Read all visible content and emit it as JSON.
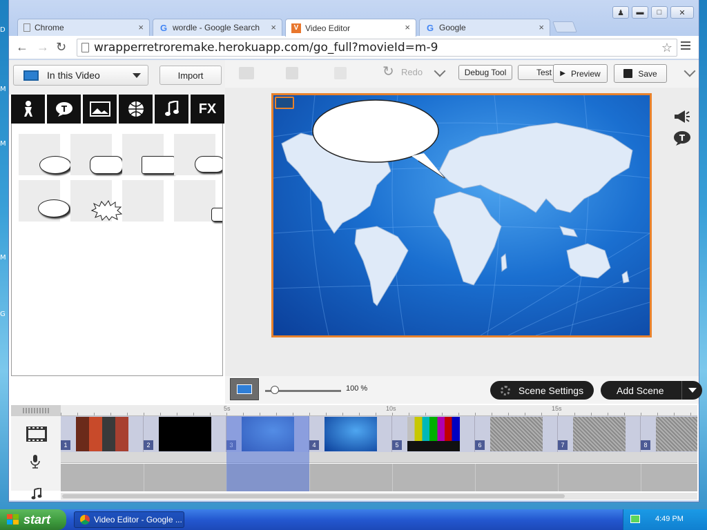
{
  "desktop": {
    "edge_letters": [
      "D",
      "M",
      "M",
      "G"
    ]
  },
  "browser": {
    "tabs": [
      {
        "label": "Chrome",
        "icon": "page-icon"
      },
      {
        "label": "wordle - Google Search",
        "icon": "google-icon"
      },
      {
        "label": "Video Editor",
        "icon": "v-logo-icon",
        "active": true
      },
      {
        "label": "Google",
        "icon": "google-icon"
      }
    ],
    "window_controls": [
      "user-icon",
      "minimize-icon",
      "maximize-icon",
      "close-icon"
    ],
    "url": "wrapperretroremake.herokuapp.com/go_full?movieId=m-9"
  },
  "library": {
    "dropdown_label": "In this Video",
    "import_label": "Import",
    "categories": [
      {
        "icon": "character-icon"
      },
      {
        "icon": "text-bubble-icon"
      },
      {
        "icon": "background-icon"
      },
      {
        "icon": "prop-icon"
      },
      {
        "icon": "music-note-icon"
      },
      {
        "label": "FX",
        "icon": "fx-icon"
      }
    ],
    "asset_type": "speech bubbles"
  },
  "toolbar": {
    "redo_label": "Redo",
    "debug_label": "Debug Tool",
    "test_label": "Test",
    "preview_label": "Preview",
    "save_label": "Save"
  },
  "stage": {
    "background": "world map",
    "accent": "#e8822c"
  },
  "zoom": {
    "value_label": "100 %",
    "level": 0.2
  },
  "scene_controls": {
    "settings_label": "Scene Settings",
    "add_label": "Add Scene"
  },
  "timeline": {
    "ruler_labels": [
      "5s",
      "10s",
      "15s"
    ],
    "scenes": [
      {
        "number": "1",
        "thumb": "arcade"
      },
      {
        "number": "2",
        "thumb": "black"
      },
      {
        "number": "3",
        "thumb": "map-bubble",
        "selected": true
      },
      {
        "number": "4",
        "thumb": "map"
      },
      {
        "number": "5",
        "thumb": "color-bars"
      },
      {
        "number": "6",
        "thumb": "static"
      },
      {
        "number": "7",
        "thumb": "static"
      },
      {
        "number": "8",
        "thumb": "static"
      }
    ],
    "tracks": [
      "film-icon",
      "microphone-icon",
      "music-note-icon"
    ]
  },
  "taskbar": {
    "start_label": "start",
    "task_label": "Video Editor - Google ...",
    "time": "4:49 PM"
  }
}
